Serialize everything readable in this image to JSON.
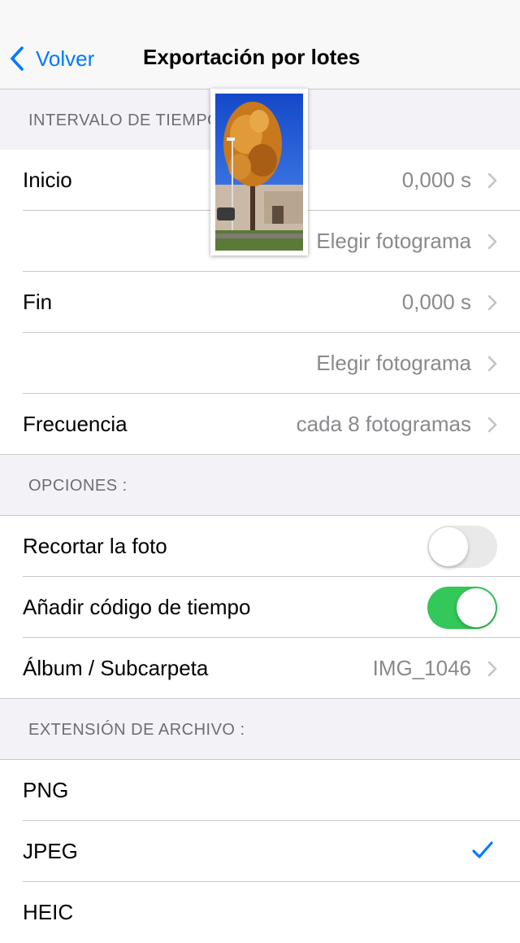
{
  "nav": {
    "back_label": "Volver",
    "title": "Exportación por lotes"
  },
  "sections": {
    "interval": {
      "header": "INTERVALO DE TIEMPO",
      "start_label": "Inicio",
      "start_value": "0,000 s",
      "start_pick": "Elegir fotograma",
      "end_label": "Fin",
      "end_value": "0,000 s",
      "end_pick": "Elegir fotograma",
      "frequency_label": "Frecuencia",
      "frequency_value": "cada 8 fotogramas"
    },
    "options": {
      "header": "OPCIONES :",
      "crop_label": "Recortar la foto",
      "crop_enabled": false,
      "timecode_label": "Añadir código de tiempo",
      "timecode_enabled": true,
      "album_label": "Álbum / Subcarpeta",
      "album_value": "IMG_1046"
    },
    "extension": {
      "header": "EXTENSIÓN DE ARCHIVO :",
      "formats": [
        "PNG",
        "JPEG",
        "HEIC"
      ],
      "selected": "JPEG"
    }
  },
  "icons": {
    "back": "chevron-left-icon",
    "disclosure": "chevron-right-icon",
    "selected": "checkmark-icon"
  },
  "colors": {
    "accent": "#007aff",
    "toggle_on": "#34c759",
    "toggle_off": "#e9e9ea",
    "secondary_text": "#8a8a8e"
  }
}
